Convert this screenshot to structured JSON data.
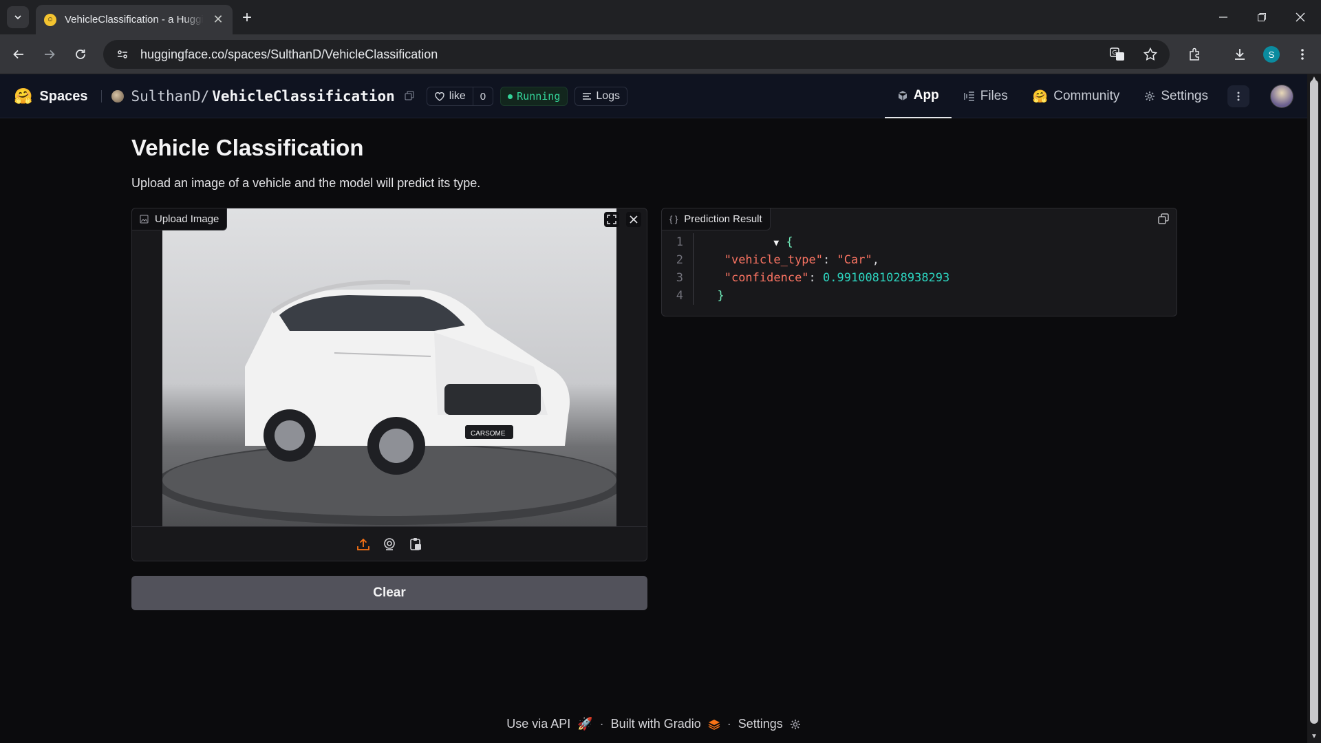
{
  "browser": {
    "tab_title": "VehicleClassification - a Huggin",
    "url": "huggingface.co/spaces/SulthanD/VehicleClassification",
    "profile_initial": "S"
  },
  "hf_header": {
    "spaces_label": "Spaces",
    "owner": "SulthanD/",
    "repo": "VehicleClassification",
    "like_label": "like",
    "like_count": "0",
    "status": "Running",
    "logs_label": "Logs",
    "nav": {
      "app": "App",
      "files": "Files",
      "community": "Community",
      "settings": "Settings"
    }
  },
  "app": {
    "title": "Vehicle Classification",
    "description": "Upload an image of a vehicle and the model will predict its type.",
    "upload_label": "Upload Image",
    "result_label": "Prediction Result",
    "clear_label": "Clear",
    "image_badge": "CARSOME"
  },
  "result_code": {
    "line_numbers": [
      "1",
      "2",
      "3",
      "4"
    ],
    "open_brace": "{",
    "key1": "\"vehicle_type\"",
    "val1": "\"Car\"",
    "key2": "\"confidence\"",
    "val2": "0.9910081028938293",
    "close_brace": "}"
  },
  "footer": {
    "api": "Use via API",
    "built": "Built with Gradio",
    "settings": "Settings"
  },
  "colors": {
    "accent_orange": "#f97316",
    "running_green": "#34d399",
    "json_key": "#f97362",
    "json_number": "#2dd4bf"
  }
}
